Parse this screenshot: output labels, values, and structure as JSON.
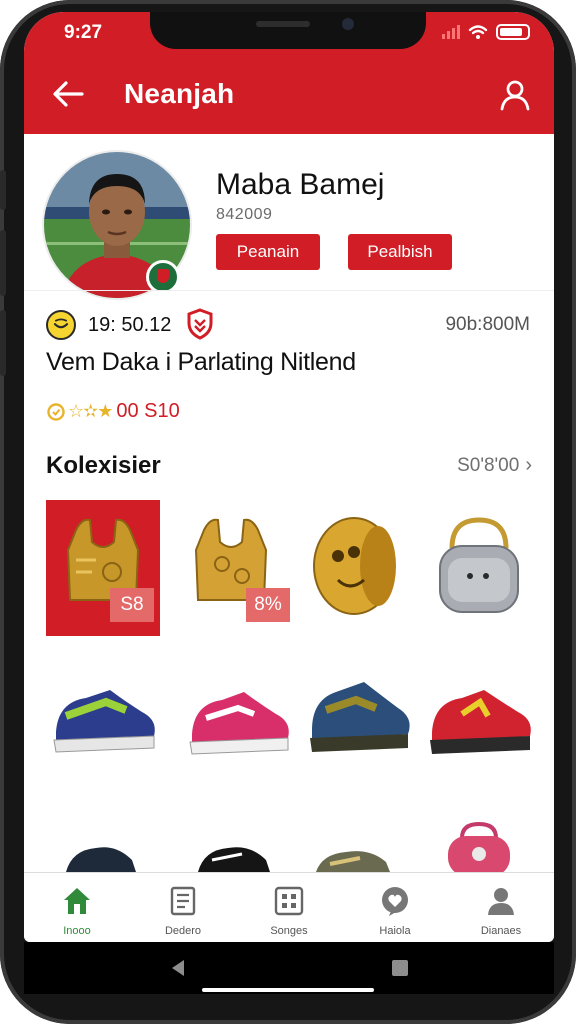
{
  "status_bar": {
    "time": "9:27"
  },
  "header": {
    "title": "Neanjah"
  },
  "profile": {
    "name": "Maba Bamej",
    "subtitle": "842009",
    "button_1": "Peanain",
    "button_2": "Pealbish"
  },
  "stats": {
    "left_value": "19: 50.12",
    "right_value": "90b:800M",
    "headline": "Vem Daka i Parlating Nitlend",
    "rating_text": "00 S10"
  },
  "collection": {
    "title": "Kolexisier",
    "link_label": "S0'8'00",
    "tag_1": "S8",
    "tag_2": "8%"
  },
  "bottom_nav": {
    "items": [
      {
        "label": "Inooo",
        "icon": "home-icon"
      },
      {
        "label": "Dedero",
        "icon": "document-icon"
      },
      {
        "label": "Songes",
        "icon": "grid-card-icon"
      },
      {
        "label": "Haiola",
        "icon": "chat-heart-icon"
      },
      {
        "label": "Dianaes",
        "icon": "person-icon"
      }
    ]
  },
  "colors": {
    "brand_red": "#d01d26",
    "active_green": "#2f8a3a"
  }
}
